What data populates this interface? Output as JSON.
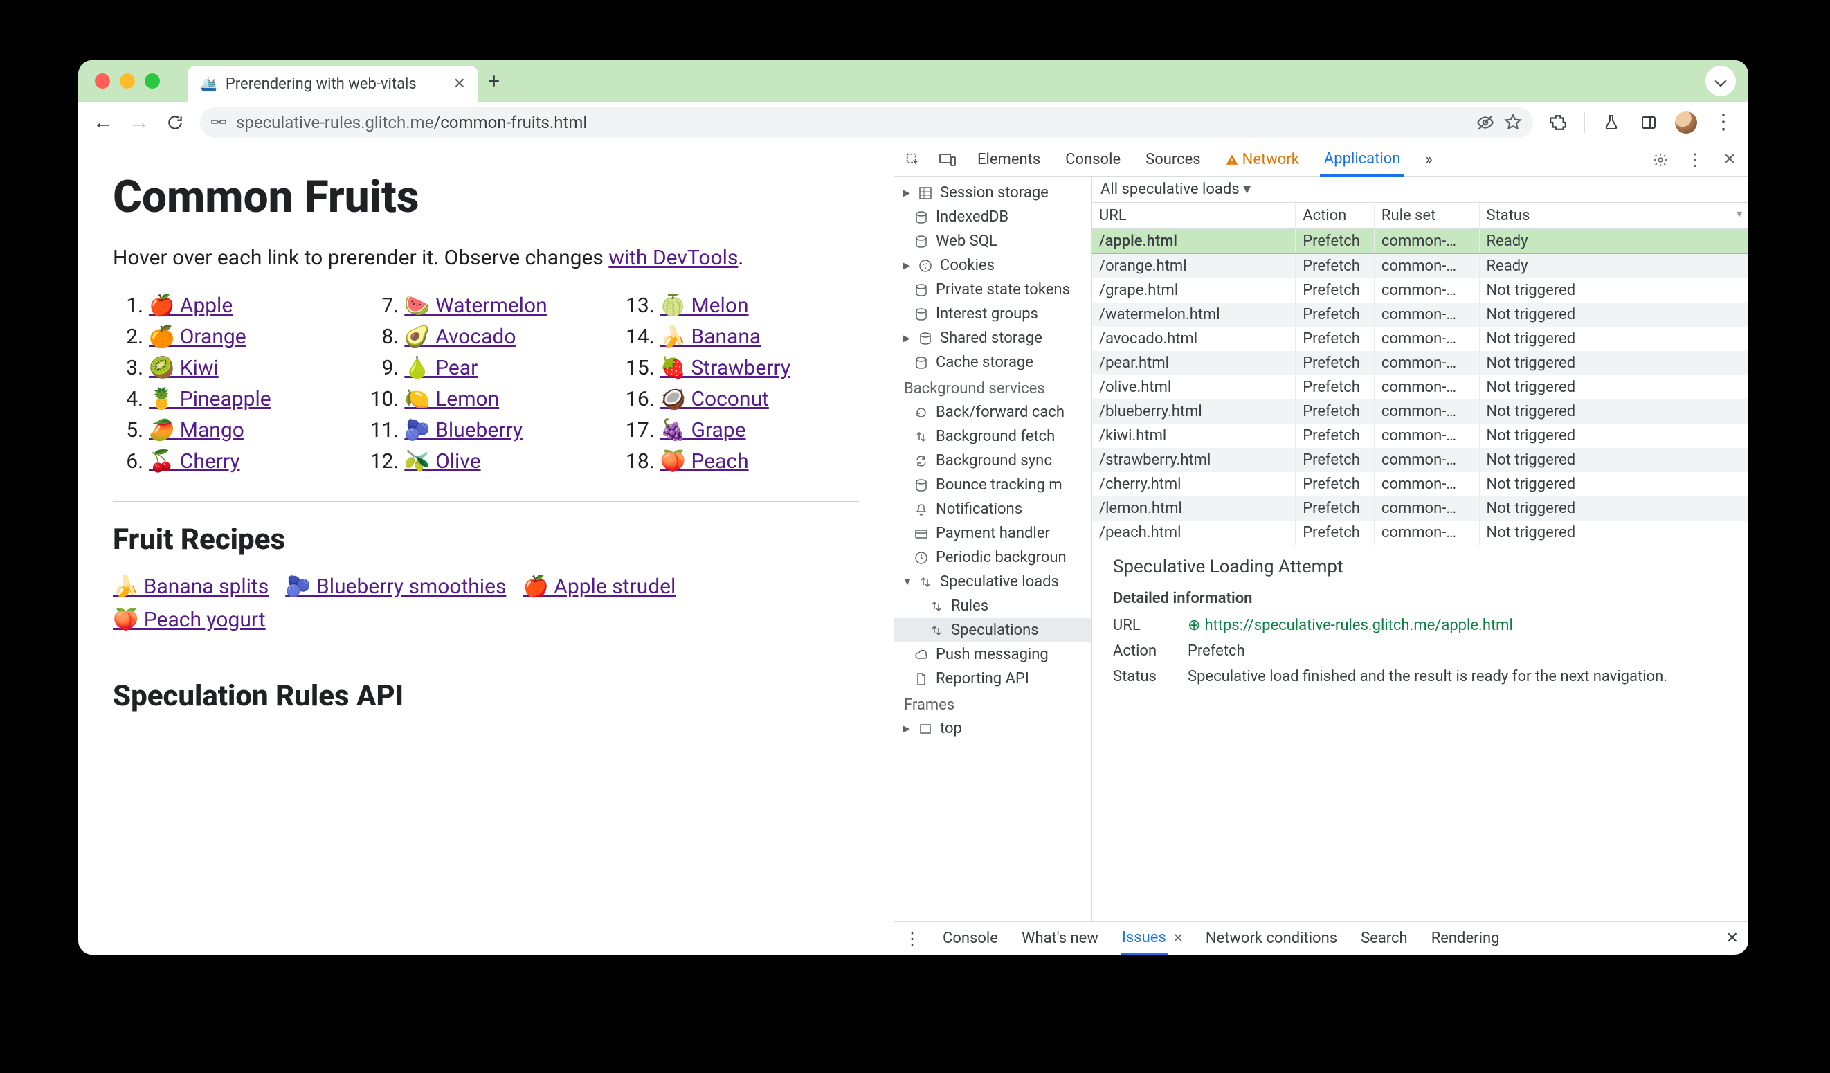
{
  "tab": {
    "title": "Prerendering with web-vitals",
    "favicon": "🛳️"
  },
  "omnibox": {
    "host": "speculative-rules.glitch.me",
    "path": "/common-fruits.html"
  },
  "page": {
    "h1": "Common Fruits",
    "intro_a": "Hover over each link to prerender it. Observe changes ",
    "intro_link": "with DevTools",
    "intro_b": ".",
    "h2a": "Fruit Recipes",
    "h2b": "Speculation Rules API",
    "fruits": [
      {
        "n": "1.",
        "e": "🍎",
        "t": "Apple"
      },
      {
        "n": "2.",
        "e": "🍊",
        "t": "Orange"
      },
      {
        "n": "3.",
        "e": "🥝",
        "t": "Kiwi"
      },
      {
        "n": "4.",
        "e": "🍍",
        "t": "Pineapple"
      },
      {
        "n": "5.",
        "e": "🥭",
        "t": "Mango"
      },
      {
        "n": "6.",
        "e": "🍒",
        "t": "Cherry"
      },
      {
        "n": "7.",
        "e": "🍉",
        "t": "Watermelon"
      },
      {
        "n": "8.",
        "e": "🥑",
        "t": "Avocado"
      },
      {
        "n": "9.",
        "e": "🍐",
        "t": "Pear"
      },
      {
        "n": "10.",
        "e": "🍋",
        "t": "Lemon"
      },
      {
        "n": "11.",
        "e": "🫐",
        "t": "Blueberry"
      },
      {
        "n": "12.",
        "e": "🫒",
        "t": "Olive"
      },
      {
        "n": "13.",
        "e": "🍈",
        "t": "Melon"
      },
      {
        "n": "14.",
        "e": "🍌",
        "t": "Banana"
      },
      {
        "n": "15.",
        "e": "🍓",
        "t": "Strawberry"
      },
      {
        "n": "16.",
        "e": "🥥",
        "t": "Coconut"
      },
      {
        "n": "17.",
        "e": "🍇",
        "t": "Grape"
      },
      {
        "n": "18.",
        "e": "🍑",
        "t": "Peach"
      }
    ],
    "recipes": [
      {
        "e": "🍌",
        "t": "Banana splits"
      },
      {
        "e": "🫐",
        "t": "Blueberry smoothies"
      },
      {
        "e": "🍎",
        "t": "Apple strudel"
      },
      {
        "e": "🍑",
        "t": "Peach yogurt"
      }
    ]
  },
  "devtools": {
    "tabs": [
      "Elements",
      "Console",
      "Sources",
      "Network",
      "Application"
    ],
    "active_tab": "Application",
    "more": "»",
    "tree": {
      "storage": [
        {
          "i": "grid",
          "t": "Session storage",
          "exp": true
        },
        {
          "i": "db",
          "t": "IndexedDB"
        },
        {
          "i": "db",
          "t": "Web SQL"
        },
        {
          "i": "cookie",
          "t": "Cookies",
          "exp": true
        },
        {
          "i": "db",
          "t": "Private state tokens"
        },
        {
          "i": "db",
          "t": "Interest groups"
        },
        {
          "i": "db",
          "t": "Shared storage",
          "exp": true
        },
        {
          "i": "db",
          "t": "Cache storage"
        }
      ],
      "bg_header": "Background services",
      "bg": [
        {
          "i": "cache",
          "t": "Back/forward cach"
        },
        {
          "i": "updown",
          "t": "Background fetch"
        },
        {
          "i": "sync",
          "t": "Background sync"
        },
        {
          "i": "db",
          "t": "Bounce tracking m"
        },
        {
          "i": "bell",
          "t": "Notifications"
        },
        {
          "i": "card",
          "t": "Payment handler"
        },
        {
          "i": "clock",
          "t": "Periodic backgroun"
        },
        {
          "i": "updown",
          "t": "Speculative loads",
          "exp": true,
          "open": true
        },
        {
          "i": "updown",
          "t": "Rules",
          "sub": true
        },
        {
          "i": "updown",
          "t": "Speculations",
          "sub": true,
          "sel": true
        },
        {
          "i": "cloud",
          "t": "Push messaging"
        },
        {
          "i": "doc",
          "t": "Reporting API"
        }
      ],
      "frames_header": "Frames",
      "frames": [
        {
          "i": "frame",
          "t": "top",
          "exp": true
        }
      ]
    },
    "filter": "All speculative loads",
    "columns": [
      "URL",
      "Action",
      "Rule set",
      "Status"
    ],
    "rows": [
      {
        "url": "/apple.html",
        "action": "Prefetch",
        "rule": "common-…",
        "status": "Ready",
        "hl": true
      },
      {
        "url": "/orange.html",
        "action": "Prefetch",
        "rule": "common-…",
        "status": "Ready"
      },
      {
        "url": "/grape.html",
        "action": "Prefetch",
        "rule": "common-…",
        "status": "Not triggered"
      },
      {
        "url": "/watermelon.html",
        "action": "Prefetch",
        "rule": "common-…",
        "status": "Not triggered"
      },
      {
        "url": "/avocado.html",
        "action": "Prefetch",
        "rule": "common-…",
        "status": "Not triggered"
      },
      {
        "url": "/pear.html",
        "action": "Prefetch",
        "rule": "common-…",
        "status": "Not triggered"
      },
      {
        "url": "/olive.html",
        "action": "Prefetch",
        "rule": "common-…",
        "status": "Not triggered"
      },
      {
        "url": "/blueberry.html",
        "action": "Prefetch",
        "rule": "common-…",
        "status": "Not triggered"
      },
      {
        "url": "/kiwi.html",
        "action": "Prefetch",
        "rule": "common-…",
        "status": "Not triggered"
      },
      {
        "url": "/strawberry.html",
        "action": "Prefetch",
        "rule": "common-…",
        "status": "Not triggered"
      },
      {
        "url": "/cherry.html",
        "action": "Prefetch",
        "rule": "common-…",
        "status": "Not triggered"
      },
      {
        "url": "/lemon.html",
        "action": "Prefetch",
        "rule": "common-…",
        "status": "Not triggered"
      },
      {
        "url": "/peach.html",
        "action": "Prefetch",
        "rule": "common-…",
        "status": "Not triggered"
      }
    ],
    "detail": {
      "title": "Speculative Loading Attempt",
      "sub": "Detailed information",
      "url_label": "URL",
      "url": "https://speculative-rules.glitch.me/apple.html",
      "action_label": "Action",
      "action": "Prefetch",
      "status_label": "Status",
      "status": "Speculative load finished and the result is ready for the next navigation."
    },
    "drawer": [
      "Console",
      "What's new",
      "Issues",
      "Network conditions",
      "Search",
      "Rendering"
    ],
    "drawer_active": "Issues"
  }
}
